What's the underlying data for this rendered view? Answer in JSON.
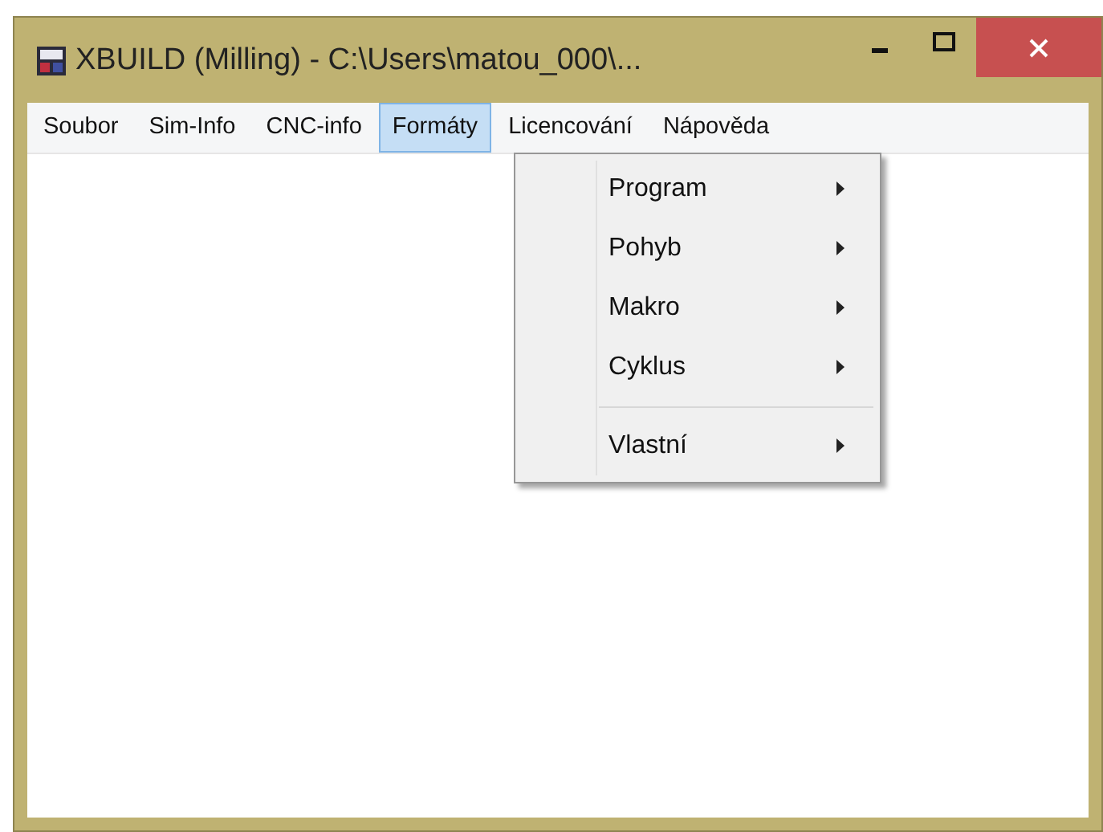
{
  "window": {
    "title": "XBUILD (Milling) - C:\\Users\\matou_000\\..."
  },
  "menu_bar": [
    {
      "label": "Soubor",
      "selected": false
    },
    {
      "label": "Sim-Info",
      "selected": false
    },
    {
      "label": "CNC-info",
      "selected": false
    },
    {
      "label": "Formáty",
      "selected": true
    },
    {
      "label": "Licencování",
      "selected": false
    },
    {
      "label": "Nápověda",
      "selected": false
    }
  ],
  "dropdown": {
    "items": [
      {
        "kind": "submenu",
        "label": "Program"
      },
      {
        "kind": "submenu",
        "label": "Pohyb"
      },
      {
        "kind": "submenu",
        "label": "Makro"
      },
      {
        "kind": "submenu",
        "label": "Cyklus"
      },
      {
        "kind": "separator"
      },
      {
        "kind": "submenu",
        "label": "Vlastní"
      }
    ]
  }
}
